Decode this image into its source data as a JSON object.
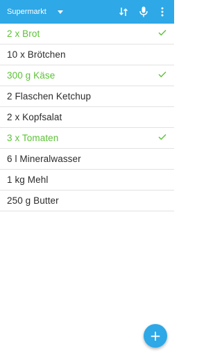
{
  "appbar": {
    "list_title": "Supermarkt",
    "icons": [
      "dropdown-icon",
      "sort-icon",
      "microphone-icon",
      "more-vert-icon"
    ]
  },
  "items": [
    {
      "label": "2 x Brot",
      "checked": true
    },
    {
      "label": "10 x Brötchen",
      "checked": false
    },
    {
      "label": "300 g Käse",
      "checked": true
    },
    {
      "label": "2 Flaschen Ketchup",
      "checked": false
    },
    {
      "label": "2 x Kopfsalat",
      "checked": false
    },
    {
      "label": "3 x Tomaten",
      "checked": true
    },
    {
      "label": "6 l Mineralwasser",
      "checked": false
    },
    {
      "label": "1 kg Mehl",
      "checked": false
    },
    {
      "label": "250 g Butter",
      "checked": false
    }
  ],
  "fab": {
    "icon": "plus-icon",
    "symbol": "+"
  },
  "colors": {
    "primary": "#2ea8e6",
    "checked": "#5bc236",
    "text": "#2b2b2b",
    "divider": "#e2e2e2"
  }
}
